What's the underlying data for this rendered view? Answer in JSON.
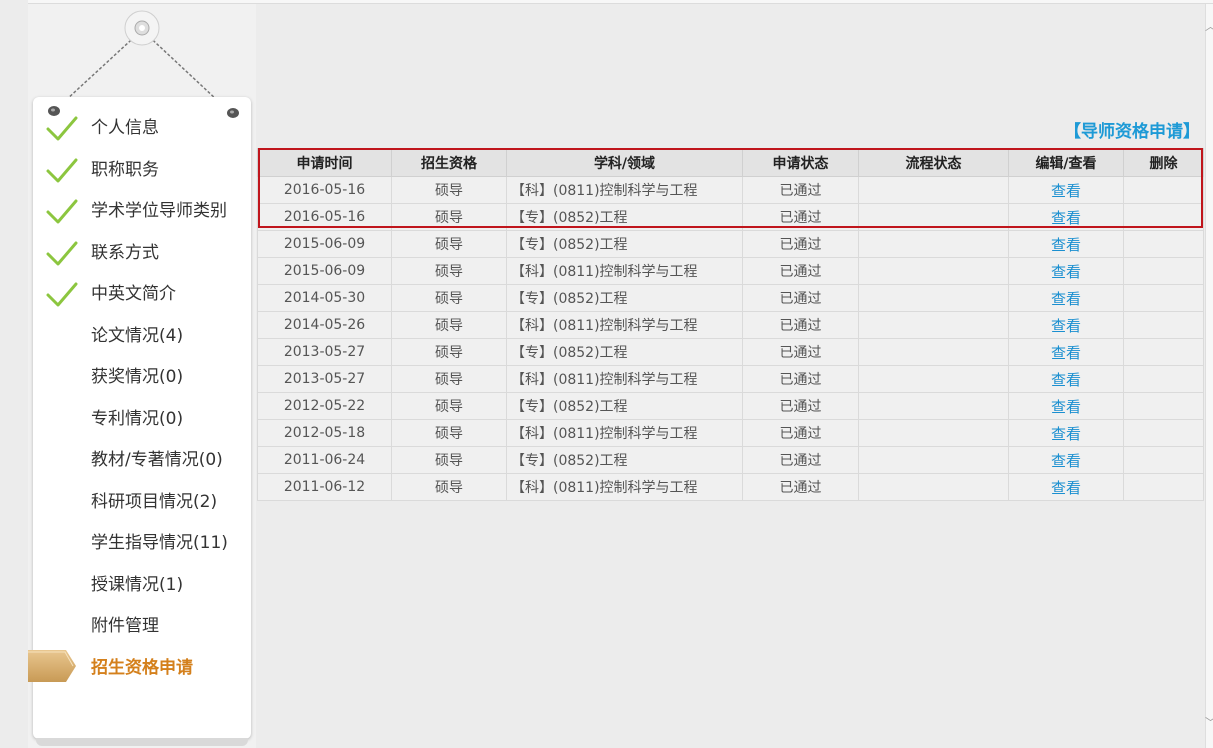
{
  "sidebar": {
    "items": [
      {
        "label": "个人信息",
        "checked": true,
        "active": false
      },
      {
        "label": "职称职务",
        "checked": true,
        "active": false
      },
      {
        "label": "学术学位导师类别",
        "checked": true,
        "active": false
      },
      {
        "label": "联系方式",
        "checked": true,
        "active": false
      },
      {
        "label": "中英文简介",
        "checked": true,
        "active": false
      },
      {
        "label": "论文情况(4)",
        "checked": false,
        "active": false
      },
      {
        "label": "获奖情况(0)",
        "checked": false,
        "active": false
      },
      {
        "label": "专利情况(0)",
        "checked": false,
        "active": false
      },
      {
        "label": "教材/专著情况(0)",
        "checked": false,
        "active": false
      },
      {
        "label": "科研项目情况(2)",
        "checked": false,
        "active": false
      },
      {
        "label": "学生指导情况(11)",
        "checked": false,
        "active": false
      },
      {
        "label": "授课情况(1)",
        "checked": false,
        "active": false
      },
      {
        "label": "附件管理",
        "checked": false,
        "active": false
      },
      {
        "label": "招生资格申请",
        "checked": false,
        "active": true
      }
    ]
  },
  "main": {
    "title": "【导师资格申请】",
    "table": {
      "headers": [
        "申请时间",
        "招生资格",
        "学科/领域",
        "申请状态",
        "流程状态",
        "编辑/查看",
        "删除"
      ],
      "rows": [
        {
          "date": "2016-05-16",
          "qual": "硕导",
          "subject": "【科】(0811)控制科学与工程",
          "status": "已通过",
          "flow": "",
          "action": "查看",
          "del": ""
        },
        {
          "date": "2016-05-16",
          "qual": "硕导",
          "subject": "【专】(0852)工程",
          "status": "已通过",
          "flow": "",
          "action": "查看",
          "del": ""
        },
        {
          "date": "2015-06-09",
          "qual": "硕导",
          "subject": "【专】(0852)工程",
          "status": "已通过",
          "flow": "",
          "action": "查看",
          "del": ""
        },
        {
          "date": "2015-06-09",
          "qual": "硕导",
          "subject": "【科】(0811)控制科学与工程",
          "status": "已通过",
          "flow": "",
          "action": "查看",
          "del": ""
        },
        {
          "date": "2014-05-30",
          "qual": "硕导",
          "subject": "【专】(0852)工程",
          "status": "已通过",
          "flow": "",
          "action": "查看",
          "del": ""
        },
        {
          "date": "2014-05-26",
          "qual": "硕导",
          "subject": "【科】(0811)控制科学与工程",
          "status": "已通过",
          "flow": "",
          "action": "查看",
          "del": ""
        },
        {
          "date": "2013-05-27",
          "qual": "硕导",
          "subject": "【专】(0852)工程",
          "status": "已通过",
          "flow": "",
          "action": "查看",
          "del": ""
        },
        {
          "date": "2013-05-27",
          "qual": "硕导",
          "subject": "【科】(0811)控制科学与工程",
          "status": "已通过",
          "flow": "",
          "action": "查看",
          "del": ""
        },
        {
          "date": "2012-05-22",
          "qual": "硕导",
          "subject": "【专】(0852)工程",
          "status": "已通过",
          "flow": "",
          "action": "查看",
          "del": ""
        },
        {
          "date": "2012-05-18",
          "qual": "硕导",
          "subject": "【科】(0811)控制科学与工程",
          "status": "已通过",
          "flow": "",
          "action": "查看",
          "del": ""
        },
        {
          "date": "2011-06-24",
          "qual": "硕导",
          "subject": "【专】(0852)工程",
          "status": "已通过",
          "flow": "",
          "action": "查看",
          "del": ""
        },
        {
          "date": "2011-06-12",
          "qual": "硕导",
          "subject": "【科】(0811)控制科学与工程",
          "status": "已通过",
          "flow": "",
          "action": "查看",
          "del": ""
        }
      ]
    }
  },
  "colors": {
    "accent": "#1e9ad6",
    "active_menu": "#d4801c",
    "check": "#8cc63f",
    "highlight_border": "#c0151c"
  }
}
